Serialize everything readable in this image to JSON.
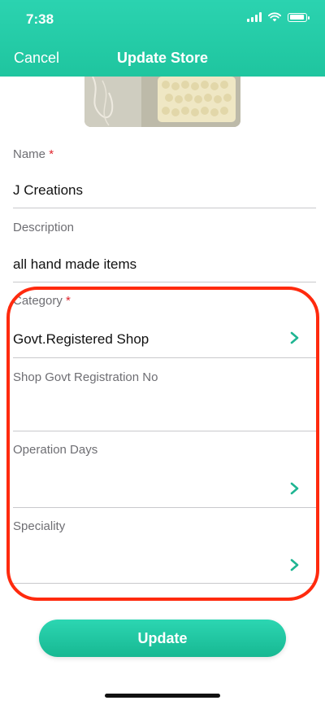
{
  "status": {
    "time": "7:38"
  },
  "nav": {
    "cancel": "Cancel",
    "title": "Update Store"
  },
  "form": {
    "name": {
      "label": "Name",
      "required_mark": "*",
      "value": "J Creations"
    },
    "description": {
      "label": "Description",
      "value": "all hand made items"
    },
    "category": {
      "label": "Category",
      "required_mark": "*",
      "value": "Govt.Registered Shop"
    },
    "registration": {
      "label": "Shop Govt Registration No",
      "value": ""
    },
    "operation_days": {
      "label": "Operation Days",
      "value": ""
    },
    "speciality": {
      "label": "Speciality",
      "value": ""
    }
  },
  "update_button": "Update",
  "colors": {
    "accent": "#1fc59f",
    "highlight": "#ff2a0e",
    "required": "#e0242c"
  },
  "icons": [
    "wifi-icon",
    "battery-icon",
    "chevron-right-icon"
  ]
}
